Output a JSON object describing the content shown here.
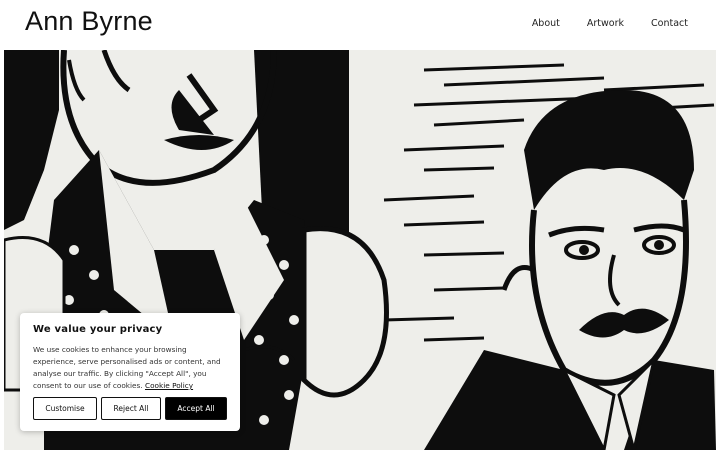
{
  "header": {
    "site_title": "Ann Byrne",
    "nav": [
      "About",
      "Artwork",
      "Contact"
    ]
  },
  "hero": {
    "description_colors": {
      "ink": "#0d0d0d",
      "paper": "#eeeeea"
    }
  },
  "cookie_banner": {
    "title": "We value your privacy",
    "text": "We use cookies to enhance your browsing experience, serve personalised ads or content, and analyse our traffic. By clicking \"Accept All\", you consent to our use of cookies.",
    "link_label": "Cookie Policy",
    "buttons": {
      "customise": "Customise",
      "reject": "Reject All",
      "accept": "Accept All"
    }
  }
}
